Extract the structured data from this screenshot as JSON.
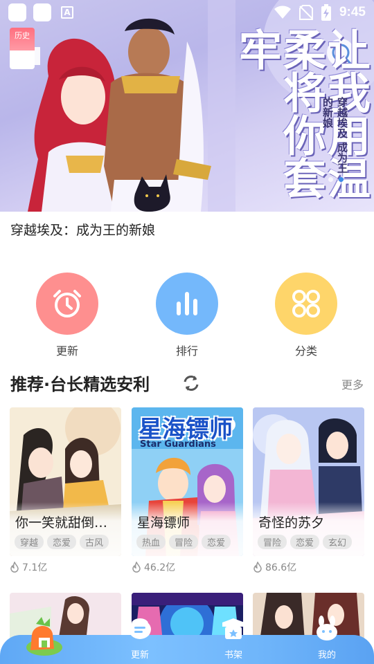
{
  "status_bar": {
    "time": "9:45"
  },
  "banner": {
    "history_label": "历史",
    "headline": "让我用温柔将你套牢",
    "subtitle": "穿越埃及 成为王的新娘",
    "caption": "穿越埃及：成为王的新娘",
    "slide_count": 2,
    "active_slide": 1
  },
  "quick_menu": [
    {
      "label": "更新",
      "icon": "alarm-clock-icon",
      "color": "#fe8f8f"
    },
    {
      "label": "排行",
      "icon": "bar-chart-icon",
      "color": "#74b8fb"
    },
    {
      "label": "分类",
      "icon": "grid-icon",
      "color": "#fed56a"
    }
  ],
  "section": {
    "title": "推荐·台长精选安利",
    "more": "更多"
  },
  "cards": [
    {
      "title": "你一笑就甜倒…",
      "tags": [
        "穿越",
        "恋爱",
        "古风"
      ],
      "heat": "7.1亿"
    },
    {
      "title": "星海镖师",
      "tags": [
        "热血",
        "冒险",
        "恋爱"
      ],
      "heat": "46.2亿",
      "cover_text": "星海镖师",
      "cover_sub": "Star Guardians"
    },
    {
      "title": "奇怪的苏夕",
      "tags": [
        "冒险",
        "恋爱",
        "玄幻"
      ],
      "heat": "86.6亿"
    }
  ],
  "bottom_nav": [
    {
      "label": "",
      "icon": "home-icon"
    },
    {
      "label": "更新",
      "icon": "update-icon"
    },
    {
      "label": "书架",
      "icon": "bookshelf-icon"
    },
    {
      "label": "我的",
      "icon": "profile-icon"
    }
  ]
}
